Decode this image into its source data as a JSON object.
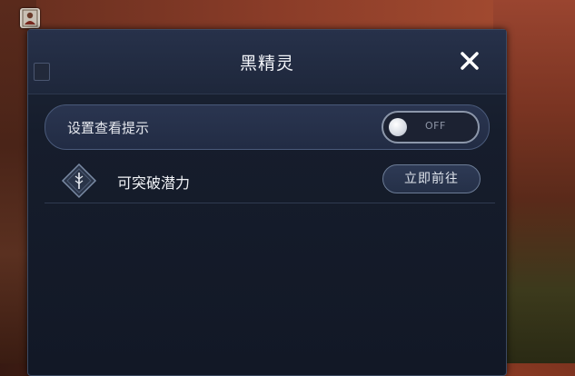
{
  "dialog": {
    "title": "黑精灵",
    "close_icon": "close-icon"
  },
  "setting": {
    "label": "设置查看提示",
    "toggle_state": "OFF"
  },
  "items": [
    {
      "label": "可突破潜力",
      "button_label": "立即前往",
      "icon": "potential-diamond-icon"
    }
  ],
  "colors": {
    "panel_bg": "#161d2c",
    "header_bg": "#27314a",
    "accent_border": "#4a5a7a",
    "text": "#f0f2f6"
  }
}
